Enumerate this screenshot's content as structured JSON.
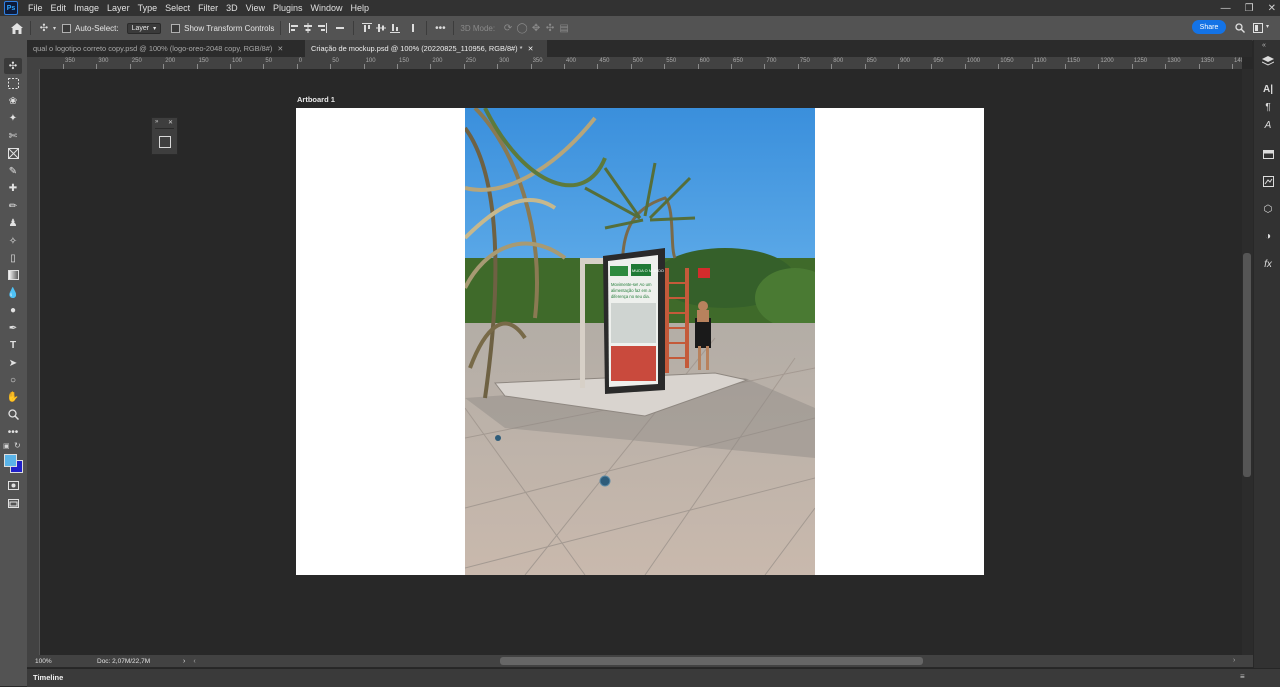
{
  "app": {
    "logo": "Ps"
  },
  "menu": [
    "File",
    "Edit",
    "Image",
    "Layer",
    "Type",
    "Select",
    "Filter",
    "3D",
    "View",
    "Plugins",
    "Window",
    "Help"
  ],
  "window_controls": [
    "minimize-icon",
    "restore-icon",
    "close-icon"
  ],
  "options_bar": {
    "auto_select_label": "Auto-Select:",
    "auto_select_value": "Layer",
    "show_transform_label": "Show Transform Controls",
    "mode_3d_label": "3D Mode:",
    "share_label": "Share"
  },
  "tabs": [
    {
      "label": "qual o logotipo correto copy.psd @ 100% (logo-oreo-2048 copy, RGB/8#)",
      "active": false
    },
    {
      "label": "Criação de mockup.psd @ 100% (20220825_110956, RGB/8#) *",
      "active": true
    }
  ],
  "ruler_labels": [
    "350",
    "300",
    "250",
    "200",
    "150",
    "100",
    "50",
    "0",
    "50",
    "100",
    "150",
    "200",
    "250",
    "300",
    "350",
    "400",
    "450",
    "500",
    "550",
    "600",
    "650",
    "700",
    "750",
    "800",
    "850",
    "900",
    "950",
    "1000",
    "1050",
    "1100",
    "1150",
    "1200",
    "1250",
    "1300",
    "1350",
    "1400"
  ],
  "artboard": {
    "label": "Artboard 1"
  },
  "poster": {
    "header": "MUDA O MUNDO",
    "text": "Movimente-se! Ao um alimentação faz em a diferença no seu dia."
  },
  "status": {
    "zoom": "100%",
    "doc": "Doc: 2,07M/22,7M"
  },
  "timeline": {
    "label": "Timeline"
  },
  "colors": {
    "foreground": "#5ab4e8",
    "background": "#2020c8",
    "accent": "#1473e6"
  }
}
